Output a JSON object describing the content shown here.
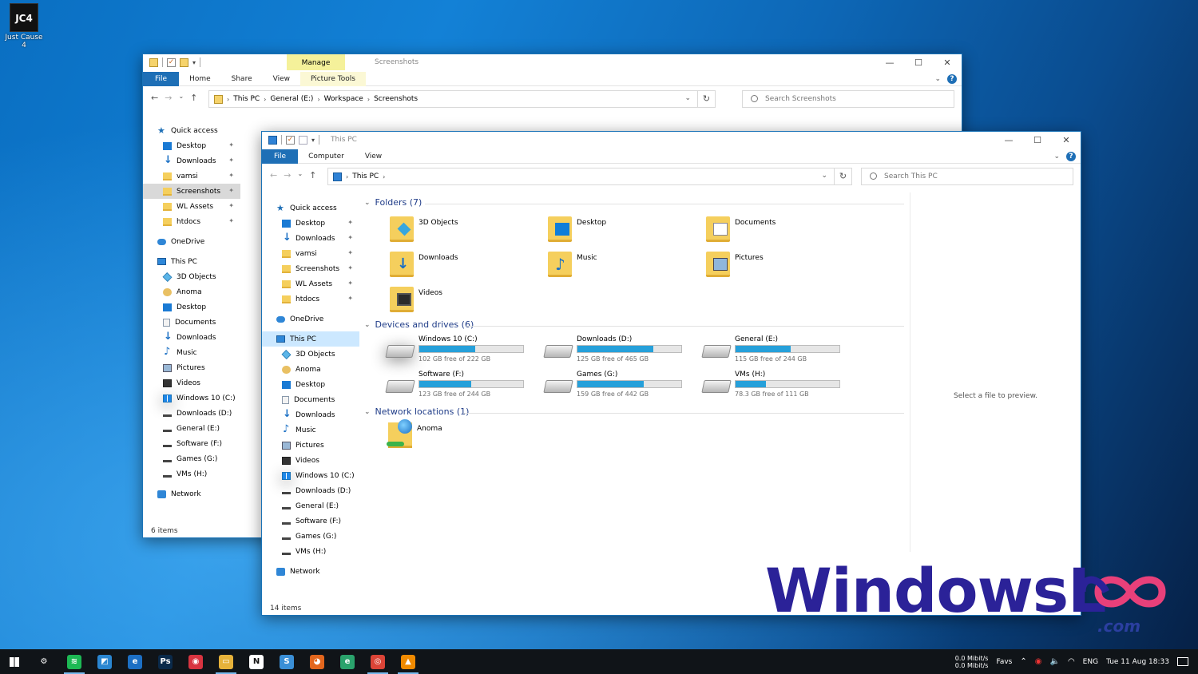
{
  "desktop": {
    "icon_tile_text": "JC4",
    "icon_label": "Just Cause 4"
  },
  "back_window": {
    "manage_tab": "Manage",
    "title": "Screenshots",
    "tabs": [
      "File",
      "Home",
      "Share",
      "View",
      "Picture Tools"
    ],
    "breadcrumb": [
      "This PC",
      "General (E:)",
      "Workspace",
      "Screenshots"
    ],
    "search_placeholder": "Search Screenshots",
    "nav": [
      {
        "label": "Quick access",
        "icon": "star-icon",
        "indent": 0
      },
      {
        "label": "Desktop",
        "icon": "desktop-icon",
        "indent": 1,
        "pin": true
      },
      {
        "label": "Downloads",
        "icon": "downloads-icon",
        "indent": 1,
        "pin": true
      },
      {
        "label": "vamsi",
        "icon": "folder-icon",
        "indent": 1,
        "pin": true
      },
      {
        "label": "Screenshots",
        "icon": "folder-icon",
        "indent": 1,
        "pin": true,
        "selected": true
      },
      {
        "label": "WL Assets",
        "icon": "folder-icon",
        "indent": 1,
        "pin": true
      },
      {
        "label": "htdocs",
        "icon": "folder-icon",
        "indent": 1,
        "pin": true
      },
      {
        "label": "",
        "gap": true
      },
      {
        "label": "OneDrive",
        "icon": "onedrive-icon",
        "indent": 0
      },
      {
        "label": "",
        "gap": true
      },
      {
        "label": "This PC",
        "icon": "this-pc-icon",
        "indent": 0
      },
      {
        "label": "3D Objects",
        "icon": "3d-objects-icon",
        "indent": 1
      },
      {
        "label": "Anoma",
        "icon": "user-icon",
        "indent": 1
      },
      {
        "label": "Desktop",
        "icon": "desktop-icon",
        "indent": 1
      },
      {
        "label": "Documents",
        "icon": "documents-icon",
        "indent": 1
      },
      {
        "label": "Downloads",
        "icon": "downloads-icon",
        "indent": 1
      },
      {
        "label": "Music",
        "icon": "music-icon",
        "indent": 1
      },
      {
        "label": "Pictures",
        "icon": "pictures-icon",
        "indent": 1
      },
      {
        "label": "Videos",
        "icon": "videos-icon",
        "indent": 1
      },
      {
        "label": "Windows 10 (C:)",
        "icon": "windows-drive-icon",
        "indent": 1
      },
      {
        "label": "Downloads  (D:)",
        "icon": "drive-icon",
        "indent": 1
      },
      {
        "label": "General (E:)",
        "icon": "drive-icon",
        "indent": 1
      },
      {
        "label": "Software (F:)",
        "icon": "drive-icon",
        "indent": 1
      },
      {
        "label": "Games (G:)",
        "icon": "drive-icon",
        "indent": 1
      },
      {
        "label": "VMs (H:)",
        "icon": "drive-icon",
        "indent": 1
      },
      {
        "label": "",
        "gap": true
      },
      {
        "label": "Network",
        "icon": "network-icon",
        "indent": 0
      }
    ],
    "status": "6 items"
  },
  "front_window": {
    "title": "This PC",
    "tabs": [
      "File",
      "Computer",
      "View"
    ],
    "breadcrumb": [
      "This PC"
    ],
    "search_placeholder": "Search This PC",
    "nav": [
      {
        "label": "Quick access",
        "icon": "star-icon",
        "indent": 0
      },
      {
        "label": "Desktop",
        "icon": "desktop-icon",
        "indent": 1,
        "pin": true
      },
      {
        "label": "Downloads",
        "icon": "downloads-icon",
        "indent": 1,
        "pin": true
      },
      {
        "label": "vamsi",
        "icon": "folder-icon",
        "indent": 1,
        "pin": true
      },
      {
        "label": "Screenshots",
        "icon": "folder-icon",
        "indent": 1,
        "pin": true
      },
      {
        "label": "WL Assets",
        "icon": "folder-icon",
        "indent": 1,
        "pin": true
      },
      {
        "label": "htdocs",
        "icon": "folder-icon",
        "indent": 1,
        "pin": true
      },
      {
        "label": "",
        "gap": true
      },
      {
        "label": "OneDrive",
        "icon": "onedrive-icon",
        "indent": 0
      },
      {
        "label": "",
        "gap": true
      },
      {
        "label": "This PC",
        "icon": "this-pc-icon",
        "indent": 0,
        "selected": true
      },
      {
        "label": "3D Objects",
        "icon": "3d-objects-icon",
        "indent": 1
      },
      {
        "label": "Anoma",
        "icon": "user-icon",
        "indent": 1
      },
      {
        "label": "Desktop",
        "icon": "desktop-icon",
        "indent": 1
      },
      {
        "label": "Documents",
        "icon": "documents-icon",
        "indent": 1
      },
      {
        "label": "Downloads",
        "icon": "downloads-icon",
        "indent": 1
      },
      {
        "label": "Music",
        "icon": "music-icon",
        "indent": 1
      },
      {
        "label": "Pictures",
        "icon": "pictures-icon",
        "indent": 1
      },
      {
        "label": "Videos",
        "icon": "videos-icon",
        "indent": 1
      },
      {
        "label": "Windows 10 (C:)",
        "icon": "windows-drive-icon",
        "indent": 1
      },
      {
        "label": "Downloads  (D:)",
        "icon": "drive-icon",
        "indent": 1
      },
      {
        "label": "General (E:)",
        "icon": "drive-icon",
        "indent": 1
      },
      {
        "label": "Software (F:)",
        "icon": "drive-icon",
        "indent": 1
      },
      {
        "label": "Games (G:)",
        "icon": "drive-icon",
        "indent": 1
      },
      {
        "label": "VMs (H:)",
        "icon": "drive-icon",
        "indent": 1
      },
      {
        "label": "",
        "gap": true
      },
      {
        "label": "Network",
        "icon": "network-icon",
        "indent": 0
      }
    ],
    "groups": {
      "folders": "Folders (7)",
      "devices": "Devices and drives (6)",
      "network": "Network locations (1)"
    },
    "folders": [
      {
        "label": "3D Objects",
        "icon": "3d-objects-icon"
      },
      {
        "label": "Desktop",
        "icon": "desktop-icon"
      },
      {
        "label": "Documents",
        "icon": "documents-icon"
      },
      {
        "label": "Downloads",
        "icon": "downloads-icon"
      },
      {
        "label": "Music",
        "icon": "music-icon"
      },
      {
        "label": "Pictures",
        "icon": "pictures-icon"
      },
      {
        "label": "Videos",
        "icon": "videos-icon"
      }
    ],
    "drives": [
      {
        "label": "Windows 10 (C:)",
        "free": "102 GB free of 222 GB",
        "used_fraction": 0.54,
        "windows": true
      },
      {
        "label": "Downloads  (D:)",
        "free": "125 GB free of 465 GB",
        "used_fraction": 0.73
      },
      {
        "label": "General (E:)",
        "free": "115 GB free of 244 GB",
        "used_fraction": 0.53
      },
      {
        "label": "Software (F:)",
        "free": "123 GB free of 244 GB",
        "used_fraction": 0.5
      },
      {
        "label": "Games (G:)",
        "free": "159 GB free of 442 GB",
        "used_fraction": 0.64
      },
      {
        "label": "VMs (H:)",
        "free": "78.3 GB free of 111 GB",
        "used_fraction": 0.29
      }
    ],
    "network_location": {
      "label": "Anoma"
    },
    "preview_text": "Select a file to preview.",
    "status": "14 items"
  },
  "watermark": {
    "brand": "WindowsL",
    "suffix": ".com"
  },
  "taskbar": {
    "apps": [
      {
        "name": "settings-icon",
        "glyph": "⚙",
        "color": "#101418",
        "active": false
      },
      {
        "name": "spotify-icon",
        "glyph": "≋",
        "color": "#1db954",
        "active": true
      },
      {
        "name": "snip-tool-icon",
        "glyph": "◩",
        "color": "#2a86d1",
        "active": false
      },
      {
        "name": "edge-legacy-icon",
        "glyph": "e",
        "color": "#1c6fc4",
        "active": false
      },
      {
        "name": "photoshop-icon",
        "glyph": "Ps",
        "color": "#0a2a4a",
        "active": false
      },
      {
        "name": "record-app-icon",
        "glyph": "◉",
        "color": "#d83440",
        "active": false
      },
      {
        "name": "file-explorer-icon",
        "glyph": "▭",
        "color": "#e6b23a",
        "active": true
      },
      {
        "name": "notion-icon",
        "glyph": "N",
        "color": "#ffffff",
        "active": false
      },
      {
        "name": "simplenote-icon",
        "glyph": "S",
        "color": "#3a8fd6",
        "active": false
      },
      {
        "name": "firefox-icon",
        "glyph": "◕",
        "color": "#e2661d",
        "active": false
      },
      {
        "name": "edge-icon",
        "glyph": "e",
        "color": "#2aa36c",
        "active": false
      },
      {
        "name": "chrome-icon",
        "glyph": "◎",
        "color": "#db4437",
        "active": true
      },
      {
        "name": "vlc-icon",
        "glyph": "▲",
        "color": "#f08a00",
        "active": true
      }
    ],
    "net_up": "0.0 Mibit/s",
    "net_down": "0.0 Mibit/s",
    "favs": "Favs",
    "lang": "ENG",
    "datetime": "Tue 11 Aug 18:33"
  }
}
